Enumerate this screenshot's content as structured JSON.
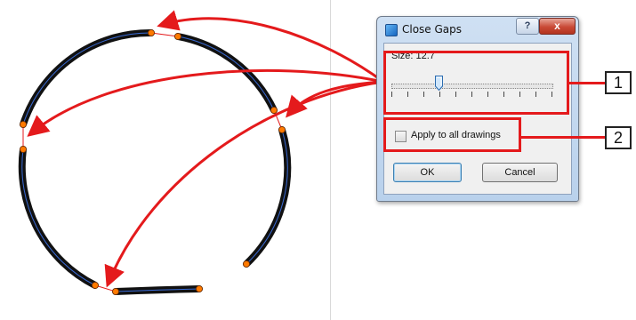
{
  "dialog": {
    "title": "Close Gaps",
    "help_glyph": "?",
    "close_glyph": "x",
    "size_label": "Size: 12.7",
    "size_value": 12.7,
    "slider_ticks": 11,
    "apply_label": "Apply to all drawings",
    "apply_checked": false,
    "ok_label": "OK",
    "cancel_label": "Cancel"
  },
  "callouts": [
    {
      "number": "1"
    },
    {
      "number": "2"
    }
  ],
  "colors": {
    "stroke": "#111111",
    "stroke_centerline": "#3a6bd6",
    "endpoint": "#ff7a00",
    "annotation": "#e41a1c"
  },
  "icons": {
    "app": "close-gaps-app-icon",
    "thumb": "slider-thumb-icon"
  }
}
